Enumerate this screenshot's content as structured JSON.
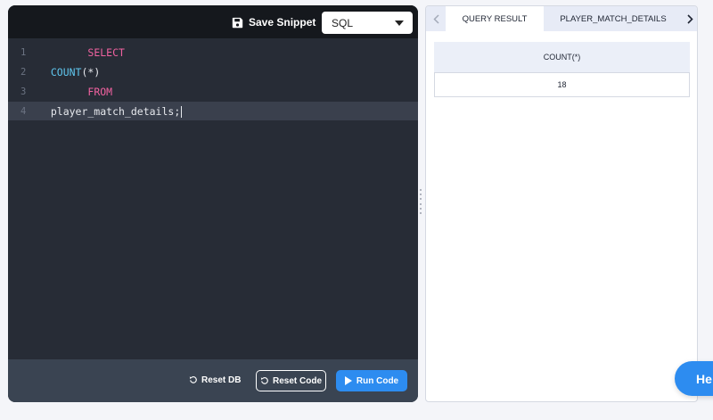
{
  "editor": {
    "save_label": "Save Snippet",
    "language": "SQL",
    "lines": [
      {
        "no": "1",
        "tokens": [
          {
            "t": "SELECT",
            "c": "kw"
          }
        ]
      },
      {
        "no": "2",
        "tokens": [
          {
            "t": "  ",
            "c": "plain"
          },
          {
            "t": "COUNT",
            "c": "fn"
          },
          {
            "t": "(*)",
            "c": "plain"
          }
        ]
      },
      {
        "no": "3",
        "tokens": [
          {
            "t": "FROM",
            "c": "kw"
          }
        ]
      },
      {
        "no": "4",
        "tokens": [
          {
            "t": "  player_match_details;",
            "c": "plain"
          }
        ]
      }
    ]
  },
  "footer": {
    "reset_db": "Reset DB",
    "reset_code": "Reset Code",
    "run_code": "Run Code"
  },
  "results": {
    "tabs": [
      "QUERY RESULT",
      "PLAYER_MATCH_DETAILS"
    ],
    "columns": [
      "COUNT(*)"
    ],
    "rows": [
      [
        "18"
      ]
    ]
  },
  "help": {
    "label": "He"
  },
  "colors": {
    "editor_bg": "#272c36",
    "header_bg": "#15181d",
    "keyword": "#f062a0",
    "function": "#5fc6ee",
    "accent": "#2d8cf0"
  }
}
